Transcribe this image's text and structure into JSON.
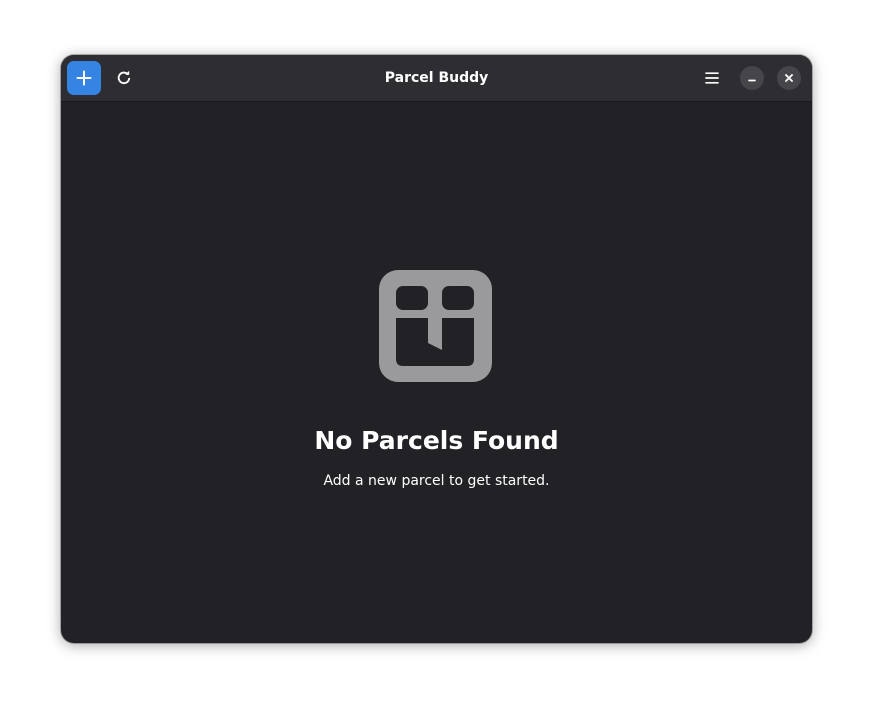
{
  "app": {
    "title": "Parcel Buddy"
  },
  "headerbar": {
    "add_icon": "plus-icon",
    "refresh_icon": "refresh-icon",
    "menu_icon": "hamburger-menu-icon",
    "minimize_icon": "minimize-icon",
    "close_icon": "close-icon"
  },
  "empty_state": {
    "icon": "parcel-box-icon",
    "title": "No Parcels Found",
    "description": "Add a new parcel to get started."
  },
  "colors": {
    "accent": "#3584e4",
    "window_bg": "#222226",
    "headerbar_bg": "#2e2e32",
    "icon_gray": "#9a9a9c",
    "text": "#ffffff"
  }
}
